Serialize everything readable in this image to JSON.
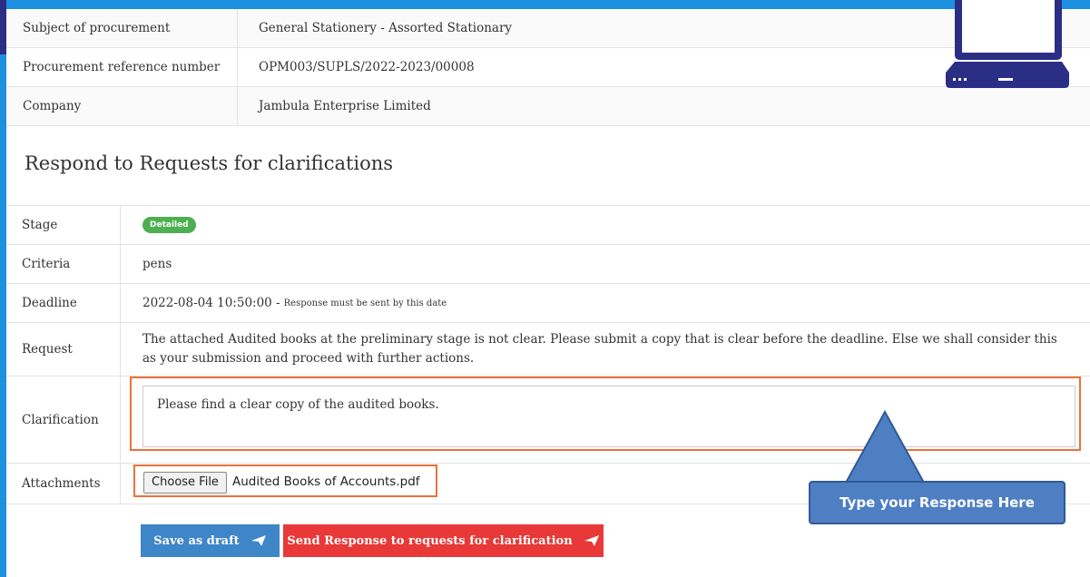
{
  "procurement": {
    "rows": [
      {
        "label": "Subject of procurement",
        "value": "General Stationery - Assorted Stationary"
      },
      {
        "label": "Procurement reference number",
        "value": "OPM003/SUPLS/2022-2023/00008"
      },
      {
        "label": "Company",
        "value": "Jambula Enterprise Limited"
      }
    ]
  },
  "section_title": "Respond to Requests for clarifications",
  "details": {
    "stage_label": "Stage",
    "stage_badge": "Detailed",
    "criteria_label": "Criteria",
    "criteria_value": "pens",
    "deadline_label": "Deadline",
    "deadline_value": "2022-08-04 10:50:00 -",
    "deadline_note": "Response must be sent by this date",
    "request_label": "Request",
    "request_value": "The attached Audited books at the preliminary stage is not clear. Please submit a copy that is clear before the deadline. Else we shall consider this as your submission and proceed with further actions.",
    "clarification_label": "Clarification",
    "clarification_value": "Please find a clear copy of the audited books.",
    "attachments_label": "Attachments",
    "choose_file_label": "Choose File",
    "file_name": "Audited Books of Accounts.pdf"
  },
  "buttons": {
    "save_draft": "Save as draft",
    "send_response": "Send Response to requests for clarification"
  },
  "callout": {
    "text": "Type your Response Here"
  },
  "colors": {
    "accent_blue": "#1e90e0",
    "highlight_orange": "#e8733a",
    "save_blue": "#3f86c8",
    "send_red": "#e83838",
    "badge_green": "#4caf50",
    "callout_blue": "#4f7fc3"
  }
}
